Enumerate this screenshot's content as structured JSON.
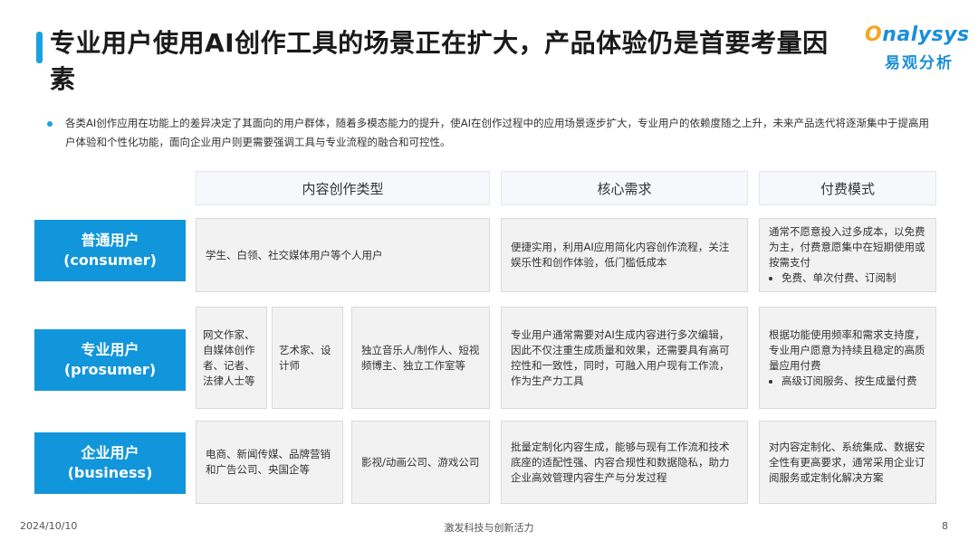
{
  "header": {
    "title": "专业用户使用AI创作工具的场景正在扩大，产品体验仍是首要考量因素",
    "logo_en_first": "O",
    "logo_en_rest": "nalysys",
    "logo_cn": "易观分析"
  },
  "intro": "各类AI创作应用在功能上的差异决定了其面向的用户群体，随着多模态能力的提升，使AI在创作过程中的应用场景逐步扩大，专业用户的依赖度随之上升，未来产品迭代将逐渐集中于提高用户体验和个性化功能，面向企业用户则更需要强调工具与专业流程的融合和可控性。",
  "columns": [
    "内容创作类型",
    "核心需求",
    "付费模式"
  ],
  "rows": [
    {
      "name": "普通用户",
      "sub": "(consumer)",
      "content_types": [
        "学生、白领、社交媒体用户等个人用户"
      ],
      "need": "便捷实用，利用AI应用简化内容创作流程，关注娱乐性和创作体验，低门槛低成本",
      "payment_text": "通常不愿意投入过多成本，以免费为主，付费意愿集中在短期使用或按需支付",
      "payment_bullets": [
        "免费、单次付费、订阅制"
      ]
    },
    {
      "name": "专业用户",
      "sub": "(prosumer)",
      "content_types": [
        "网文作家、自媒体创作者、记者、法律人士等",
        "艺术家、设计师",
        "独立音乐人/制作人、短视频博主、独立工作室等"
      ],
      "need": "专业用户通常需要对AI生成内容进行多次编辑，因此不仅注重生成质量和效果，还需要具有高可控性和一致性，同时，可融入用户现有工作流，作为生产力工具",
      "payment_text": "根据功能使用频率和需求支持度，专业用户愿意为持续且稳定的高质量应用付费",
      "payment_bullets": [
        "高级订阅服务、按生成量付费"
      ]
    },
    {
      "name": "企业用户",
      "sub": "(business)",
      "content_types": [
        "电商、新闻传媒、品牌营销和广告公司、央国企等",
        "影视/动画公司、游戏公司"
      ],
      "need": "批量定制化内容生成，能够与现有工作流和技术底座的适配性强、内容合规性和数据隐私，助力企业高效管理内容生产与分发过程",
      "payment_text": "对内容定制化、系统集成、数据安全性有更高要求，通常采用企业订阅服务或定制化解决方案",
      "payment_bullets": []
    }
  ],
  "footer": {
    "date": "2024/10/10",
    "slogan": "激发科技与创新活力",
    "page": "8"
  },
  "colors": {
    "accent": "#1296db",
    "cell_bg": "#f2f2f2",
    "header_bg": "#f6f8fb"
  }
}
